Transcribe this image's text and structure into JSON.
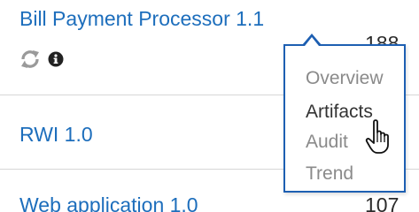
{
  "rows": [
    {
      "name": "Bill Payment Processor 1.1",
      "count": "188"
    },
    {
      "name": "RWI 1.0",
      "count": ""
    },
    {
      "name": "Web application 1.0",
      "count": "107"
    }
  ],
  "row_icons": [
    "refresh-icon",
    "info-icon"
  ],
  "menu": {
    "items": [
      {
        "label": "Overview",
        "state": "muted"
      },
      {
        "label": "Artifacts",
        "state": "active"
      },
      {
        "label": "Audit",
        "state": "muted"
      },
      {
        "label": "Trend",
        "state": "muted"
      }
    ]
  },
  "colors": {
    "link": "#1d6ebc",
    "menu_border": "#1d5fb2",
    "muted_text": "#8a8a8a",
    "active_text": "#333333",
    "divider": "#d6d6d6",
    "icon_gray": "#9a9a9a"
  }
}
